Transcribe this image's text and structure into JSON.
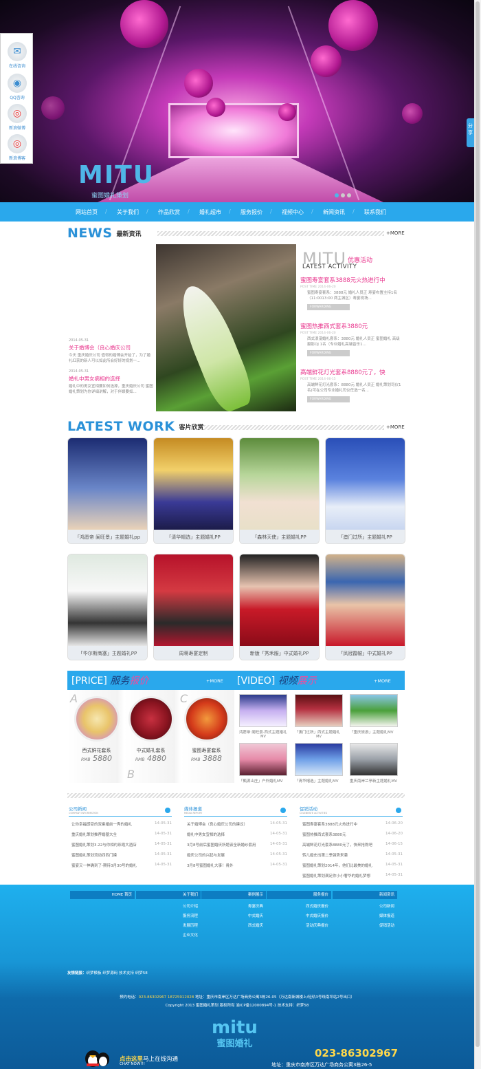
{
  "hero": {
    "logo": "MITU",
    "logo_sub": "蜜图婚礼策划"
  },
  "sidebar": [
    {
      "label": "在线咨询",
      "icon": "chat-icon",
      "glyph": "✉"
    },
    {
      "label": "QQ咨询",
      "icon": "qq-penguin-icon",
      "glyph": "◉"
    },
    {
      "label": "新浪微博",
      "icon": "weibo-icon",
      "glyph": "◎"
    },
    {
      "label": "新浪博客",
      "icon": "weibo-blog-icon",
      "glyph": "◎"
    }
  ],
  "share": "分享",
  "nav": [
    "网站首页",
    "关于我们",
    "作品欣赏",
    "婚礼超市",
    "服务报价",
    "视频中心",
    "新闻资讯",
    "联系我们"
  ],
  "news": {
    "title_en": "NEWS",
    "title_cn": "最新资讯",
    "more": "+MORE",
    "items": [
      {
        "date": "2014-05-31",
        "title": "关于婚博会（良心婚庆公司",
        "text": "今天 重庆婚庆公司 值得的婚博会开始了，为了婚礼红获的新人可以如此所会好好的规划一..."
      },
      {
        "date": "2014-05-31",
        "title": "婚礼中男女病相的选择",
        "text": "婚礼中的男女宜相要如何选择，重庆婚庆公司 蜜图婚礼策划为你详细讲解，对于伴娘要如..."
      }
    ]
  },
  "activity": {
    "logo": "MITU",
    "cn": "优惠活动",
    "en": "LATEST ACTIVITY",
    "button": "FORWARDING",
    "items": [
      {
        "title": "蜜图寿宴套系3888元火热进行中",
        "date": "POST TIME 2014-06-20",
        "text": "蜜图寿宴套系：3888元 婚礼人员正 寿宴布置主持1名（11:0013:00 两主城区）寿宴现场..."
      },
      {
        "title": "蜜图热推西式套系3880元",
        "date": "POST TIME 2014-06-20",
        "text": "西式浪漫婚礼套系：3880元 婚礼人员正 蜜图婚礼 高级摄影DJ 1名（专业婚礼高端音乐1..."
      },
      {
        "title": "高端鲜花灯光套系8880元了，快",
        "date": "POST TIME 2014-06-15",
        "text": "高端鲜花灯光套系：8880元 婚礼人员正 婚礼策划司仪1名(可在公司专业婚礼司仪任选一名..."
      }
    ]
  },
  "latest_work": {
    "title_en": "LATEST WORK",
    "title_cn": "客片欣赏",
    "more": "+MORE",
    "items": [
      "「鸿愿帝 阑旺景」主题婚礼pp",
      "「清华帽选」主题婚礼PP",
      "「森林天使」主题婚礼PP",
      "「澳门过所」主题婚礼PP",
      "「华尔斯商塞」主题婚礼PP",
      "周蒋寿宴定制",
      "新版「秀禾服」中式婚礼PP",
      "「凤冠霞帔」中式婚礼PP"
    ]
  },
  "price": {
    "label": "[PRICE]",
    "cn1": "服务",
    "cn2": "报价",
    "more": "+MORE",
    "items": [
      {
        "letter": "A",
        "name": "西式鲜花套系",
        "prefix": "RMB",
        "value": "5880"
      },
      {
        "letter": "B",
        "name": "中式婚礼套系",
        "prefix": "RMB",
        "value": "4880"
      },
      {
        "letter": "C",
        "name": "蜜图寿宴套系",
        "prefix": "RMB",
        "value": "3888"
      }
    ]
  },
  "video": {
    "label": "[VIDEO]",
    "cn1": "视频",
    "cn2": "展示",
    "more": "+MORE",
    "items": [
      {
        "cap": "鸿愿帝 阑旺景·西式主题婚礼",
        "sub": "MV"
      },
      {
        "cap": "「澳门过所」西式主题婚礼",
        "sub": "MV"
      },
      {
        "cap": "「重庆旅游」主题婚礼MV",
        "sub": ""
      },
      {
        "cap": "「甄源山庄」户外婚礼MV",
        "sub": ""
      },
      {
        "cap": "「清华帽选」主题婚礼MV",
        "sub": ""
      },
      {
        "cap": "重庆南岸兰亭新主题婚礼MV",
        "sub": ""
      }
    ]
  },
  "info": [
    {
      "title": "公司新闻",
      "en": "COMPANY INFORMATION",
      "rows": [
        [
          "让你幸福感受的双乘婚前一秀的婚礼",
          "14-05-31"
        ],
        [
          "重庆婚礼策划推荐婚墓大全",
          "14-05-31"
        ],
        [
          "蜜图婚礼策划3.22与你相约彩霞大酒店",
          "14-05-31"
        ],
        [
          "蜜图婚礼策划流动四四门摸",
          "14-05-31"
        ],
        [
          "蜜宴又一神确到了-期待3月30号的婚礼",
          "14-05-31"
        ]
      ]
    },
    {
      "title": "媒体报道",
      "en": "MEDIA REPORT",
      "rows": [
        [
          "关于婚博会（良心婚庆公司的建议）",
          "14-05-31"
        ],
        [
          "婚礼中男女宜相的选择",
          "14-05-31"
        ],
        [
          "3月8号前后蜜图婚庆所题该全新婚纱套用",
          "14-05-31"
        ],
        [
          "婚庆公司的兴起与发展",
          "14-05-31"
        ],
        [
          "3月8号蜜图婚礼大事！骨外",
          "14-05-31"
        ]
      ]
    },
    {
      "title": "促销活动",
      "en": "CELEBRATE ACTIVITIES",
      "rows": [
        [
          "蜜图寿宴套系3888元火热进行中",
          "14-06-20"
        ],
        [
          "蜜图热推西式套系3880元",
          "14-06-20"
        ],
        [
          "高端鲜花灯光套系8880元了，快来抢购吧",
          "14-06-15"
        ],
        [
          "转儿婚史出第二季强势来袭",
          "14-05-31"
        ],
        [
          "蜜图婚礼策划2014年，他们比最美的婚礼",
          "14-05-31"
        ],
        [
          "蜜图婚礼策划满足你小小奢华的婚礼梦想",
          "14-05-31"
        ]
      ]
    }
  ],
  "footer_cols": [
    {
      "head": "HOME  首页",
      "links": []
    },
    {
      "head": "关于我们",
      "links": [
        "公司介绍",
        "服务流程",
        "发展历程",
        "企业文化"
      ]
    },
    {
      "head": "案例展示",
      "links": [
        "寿宴庆典",
        "中式婚庆",
        "西式婚庆"
      ]
    },
    {
      "head": "服务报价",
      "links": [
        "西式婚庆报价",
        "中式婚庆报价",
        "活动庆典报价"
      ]
    },
    {
      "head": "新闻资讯",
      "links": [
        "公司新闻",
        "媒体报道",
        "促销活动"
      ]
    }
  ],
  "links": {
    "label": "友情链接：",
    "items": "织梦模板 织梦源码 技术支持 织梦58"
  },
  "contact": {
    "phone_label": "预约电话：",
    "phones": "023-86302967 18725912028",
    "address": " 地址：重庆市南岸区万达广场商务公寓3栋26-05（万达南新城楼上/轻轨3号线南坪站2号出口）",
    "copyright": "Copyright 2013 蜜图婚礼策划 版权所有 渝ICP备12000894号-1 技术支持：织梦58"
  },
  "footer_logo": {
    "en": "mitu",
    "cn": "蜜图婚礼"
  },
  "chat": {
    "hi": "点击这里",
    "rest": "马上在线沟通",
    "en": "CHAT NOW!!!"
  },
  "phone_big": "023-86302967",
  "address_bottom": "地址：重庆市南岸区万达广场商务公寓3栋26-5"
}
